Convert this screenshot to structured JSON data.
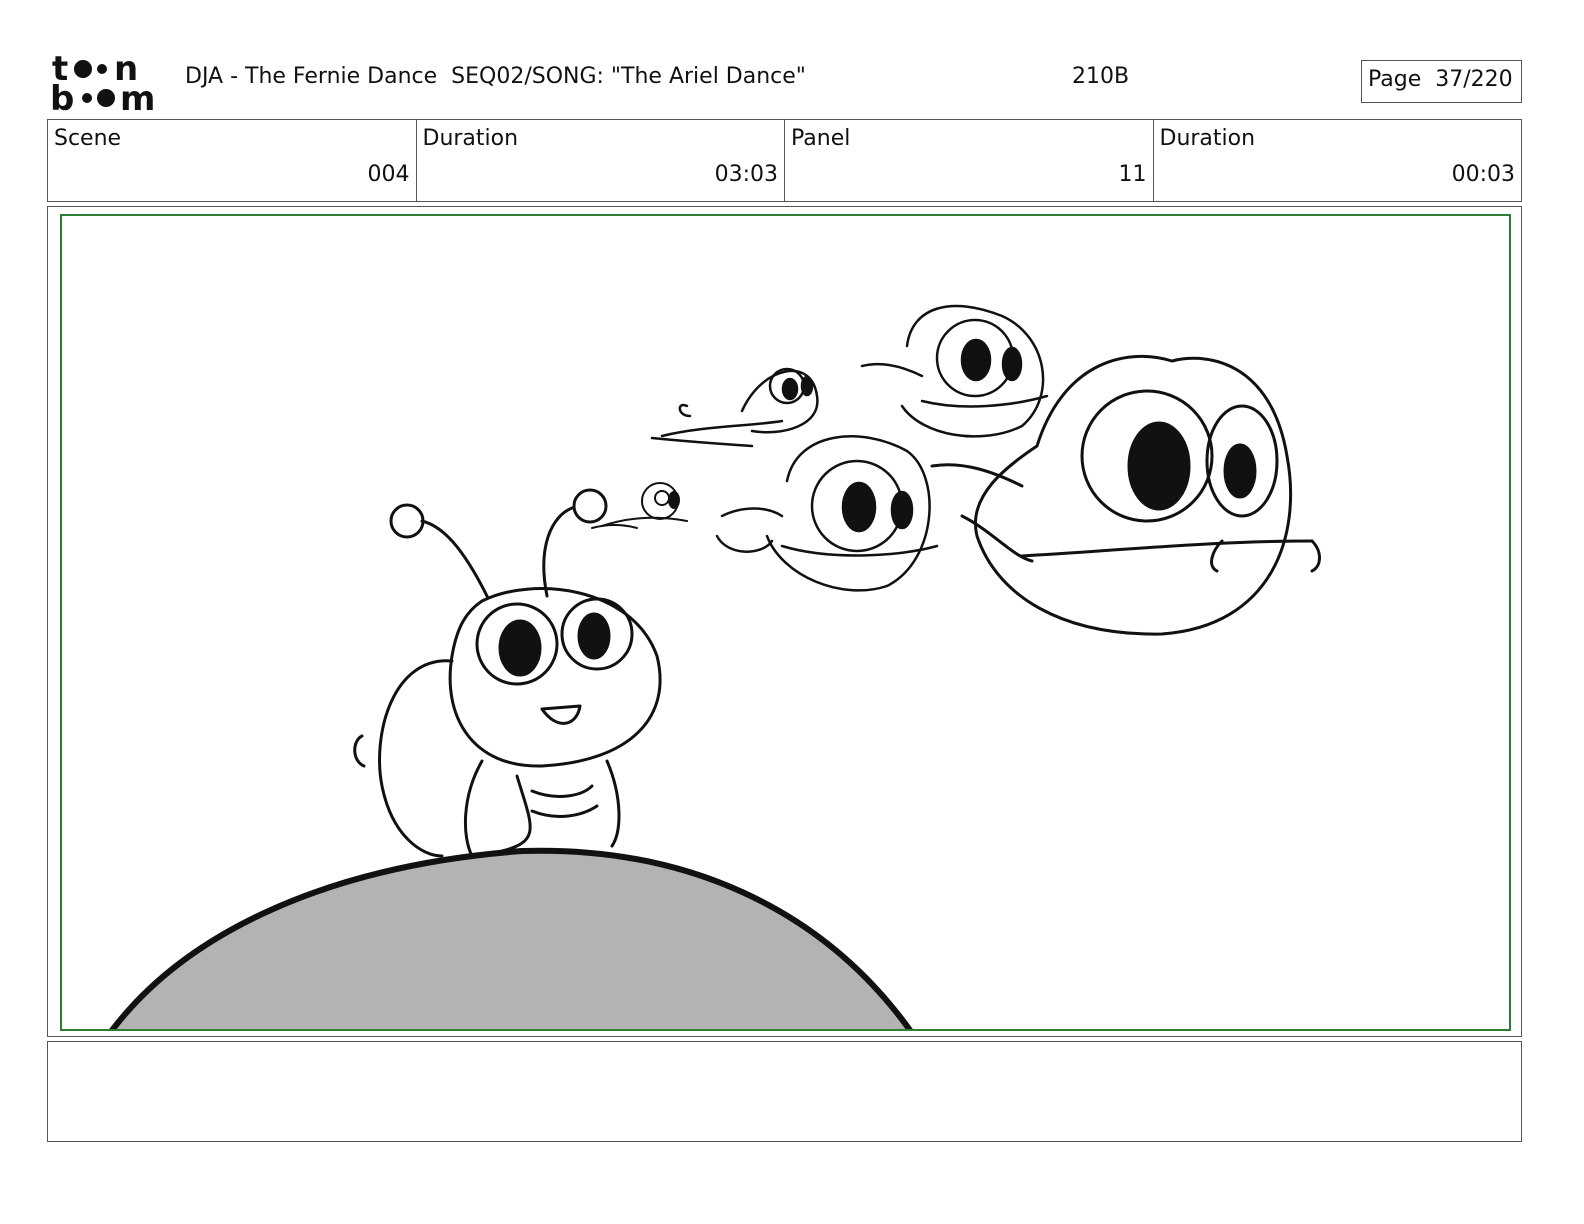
{
  "logo": {
    "text": "toon boom",
    "icon": "toon-boom-logo"
  },
  "header": {
    "title": "DJA - The Fernie Dance  SEQ02/SONG: \"The Ariel Dance\"",
    "code": "210B",
    "page": "Page  37/220"
  },
  "info": {
    "scene_label": "Scene",
    "scene_value": "004",
    "duration_label": "Duration",
    "duration_value": "03:03",
    "panel_label": "Panel",
    "panel_value": "11",
    "panel_duration_label": "Duration",
    "panel_duration_value": "00:03"
  },
  "panel": {
    "frame_color": "#2e7d32",
    "hill_color": "#b3b3b3"
  },
  "notes": {
    "text": ""
  }
}
